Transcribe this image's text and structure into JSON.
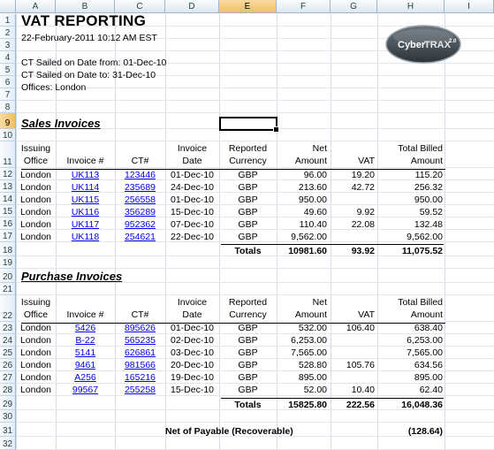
{
  "columns": [
    "A",
    "B",
    "C",
    "D",
    "E",
    "F",
    "G",
    "H",
    "I"
  ],
  "selected_column": "E",
  "selected_row": "9",
  "rows": [
    "1",
    "2",
    "3",
    "4",
    "5",
    "6",
    "7",
    "8",
    "9",
    "10",
    "11",
    "12",
    "13",
    "14",
    "15",
    "16",
    "17",
    "18",
    "19",
    "20",
    "21",
    "22",
    "23",
    "24",
    "25",
    "26",
    "27",
    "28",
    "29",
    "30",
    "31",
    "32"
  ],
  "report": {
    "title": "VAT REPORTING",
    "datetime": "22-February-2011 10:12 AM EST",
    "from_line": "CT Sailed on Date from: 01-Dec-10",
    "to_line": "CT Sailed on Date to: 31-Dec-10",
    "offices_line": "Offices: London"
  },
  "logo": {
    "text_a": "Cyber",
    "text_b": "TRAX",
    "version": "2.0"
  },
  "headers": {
    "office": [
      "Issuing",
      "Office"
    ],
    "invoice": [
      "",
      "Invoice #"
    ],
    "ct": [
      "",
      "CT#"
    ],
    "date": [
      "Invoice",
      "Date"
    ],
    "currency": [
      "Reported",
      "Currency"
    ],
    "net": [
      "Net",
      "Amount"
    ],
    "vat": [
      "",
      "VAT"
    ],
    "total": [
      "Total Billed",
      "Amount"
    ]
  },
  "sales": {
    "title": "Sales Invoices",
    "rows": [
      {
        "office": "London",
        "invoice": "UK113",
        "ct": "123446",
        "date": "01-Dec-10",
        "currency": "GBP",
        "net": "96.00",
        "vat": "19.20",
        "total": "115.20"
      },
      {
        "office": "London",
        "invoice": "UK114",
        "ct": "235689",
        "date": "24-Dec-10",
        "currency": "GBP",
        "net": "213.60",
        "vat": "42.72",
        "total": "256.32"
      },
      {
        "office": "London",
        "invoice": "UK115",
        "ct": "256558",
        "date": "01-Dec-10",
        "currency": "GBP",
        "net": "950.00",
        "vat": "",
        "total": "950.00"
      },
      {
        "office": "London",
        "invoice": "UK116",
        "ct": "356289",
        "date": "15-Dec-10",
        "currency": "GBP",
        "net": "49.60",
        "vat": "9.92",
        "total": "59.52"
      },
      {
        "office": "London",
        "invoice": "UK117",
        "ct": "952362",
        "date": "07-Dec-10",
        "currency": "GBP",
        "net": "110.40",
        "vat": "22.08",
        "total": "132.48"
      },
      {
        "office": "London",
        "invoice": "UK118",
        "ct": "254621",
        "date": "22-Dec-10",
        "currency": "GBP",
        "net": "9,562.00",
        "vat": "",
        "total": "9,562.00"
      }
    ],
    "totals_label": "Totals",
    "net_total": "10981.60",
    "vat_total": "93.92",
    "grand_total": "11,075.52"
  },
  "purchase": {
    "title": "Purchase Invoices",
    "rows": [
      {
        "office": "London",
        "invoice": "5426",
        "ct": "895626",
        "date": "01-Dec-10",
        "currency": "GBP",
        "net": "532.00",
        "vat": "106.40",
        "total": "638.40"
      },
      {
        "office": "London",
        "invoice": "B-22",
        "ct": "565235",
        "date": "02-Dec-10",
        "currency": "GBP",
        "net": "6,253.00",
        "vat": "",
        "total": "6,253.00"
      },
      {
        "office": "London",
        "invoice": "5141",
        "ct": "626861",
        "date": "03-Dec-10",
        "currency": "GBP",
        "net": "7,565.00",
        "vat": "",
        "total": "7,565.00"
      },
      {
        "office": "London",
        "invoice": "9461",
        "ct": "981566",
        "date": "20-Dec-10",
        "currency": "GBP",
        "net": "528.80",
        "vat": "105.76",
        "total": "634.56"
      },
      {
        "office": "London",
        "invoice": "A256",
        "ct": "165216",
        "date": "19-Dec-10",
        "currency": "GBP",
        "net": "895.00",
        "vat": "",
        "total": "895.00"
      },
      {
        "office": "London",
        "invoice": "99567",
        "ct": "255258",
        "date": "15-Dec-10",
        "currency": "GBP",
        "net": "52.00",
        "vat": "10.40",
        "total": "62.40"
      }
    ],
    "totals_label": "Totals",
    "net_total": "15825.80",
    "vat_total": "222.56",
    "grand_total": "16,048.36"
  },
  "net_payable": {
    "label": "Net of Payable (Recoverable)",
    "value": "(128.64)"
  }
}
